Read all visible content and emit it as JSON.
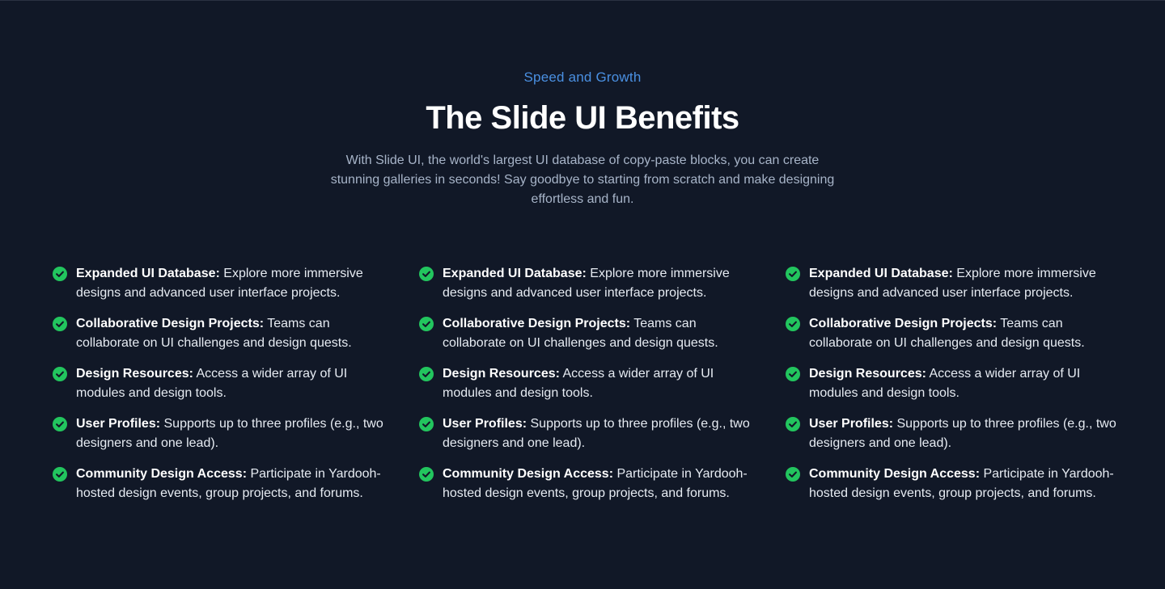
{
  "section": {
    "eyebrow": "Speed and Growth",
    "title": "The Slide UI Benefits",
    "description": "With Slide UI, the world's largest UI database of copy-paste blocks, you can create stunning galleries in seconds! Say goodbye to starting from scratch and make designing effortless and fun."
  },
  "columns": [
    {
      "features": [
        {
          "title": "Expanded UI Database:",
          "text": " Explore more immersive designs and advanced user interface projects."
        },
        {
          "title": "Collaborative Design Projects:",
          "text": " Teams can collaborate on UI challenges and design quests."
        },
        {
          "title": "Design Resources:",
          "text": " Access a wider array of UI modules and design tools."
        },
        {
          "title": "User Profiles:",
          "text": " Supports up to three profiles (e.g., two designers and one lead)."
        },
        {
          "title": "Community Design Access:",
          "text": " Participate in Yardooh-hosted design events, group projects, and forums."
        }
      ]
    },
    {
      "features": [
        {
          "title": "Expanded UI Database:",
          "text": " Explore more immersive designs and advanced user interface projects."
        },
        {
          "title": "Collaborative Design Projects:",
          "text": " Teams can collaborate on UI challenges and design quests."
        },
        {
          "title": "Design Resources:",
          "text": " Access a wider array of UI modules and design tools."
        },
        {
          "title": "User Profiles:",
          "text": " Supports up to three profiles (e.g., two designers and one lead)."
        },
        {
          "title": "Community Design Access:",
          "text": " Participate in Yardooh-hosted design events, group projects, and forums."
        }
      ]
    },
    {
      "features": [
        {
          "title": "Expanded UI Database:",
          "text": " Explore more immersive designs and advanced user interface projects."
        },
        {
          "title": "Collaborative Design Projects:",
          "text": " Teams can collaborate on UI challenges and design quests."
        },
        {
          "title": "Design Resources:",
          "text": " Access a wider array of UI modules and design tools."
        },
        {
          "title": "User Profiles:",
          "text": " Supports up to three profiles (e.g., two designers and one lead)."
        },
        {
          "title": "Community Design Access:",
          "text": " Participate in Yardooh-hosted design events, group projects, and forums."
        }
      ]
    }
  ],
  "icons": {
    "check": "check-circle-icon"
  },
  "colors": {
    "background": "#111827",
    "accent": "#4a90e2",
    "check": "#22c55e"
  }
}
